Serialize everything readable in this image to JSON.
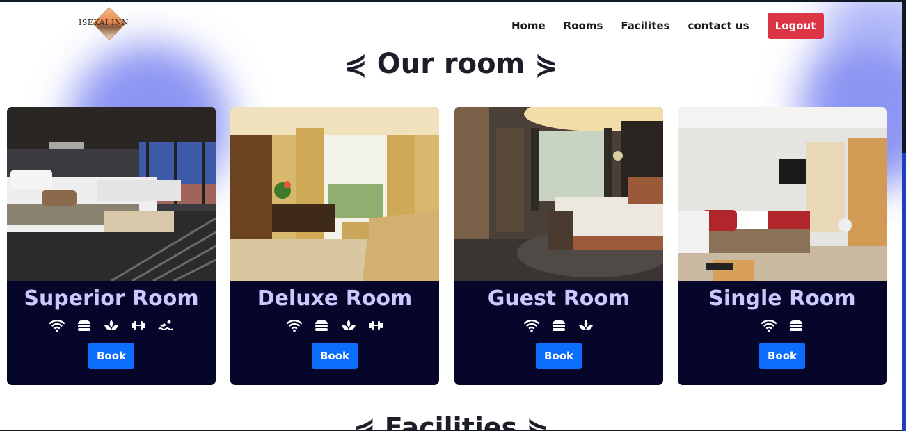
{
  "header": {
    "brand": "ISEKAI INN",
    "nav": [
      "Home",
      "Rooms",
      "Facilites",
      "contact us"
    ],
    "logout_label": "Logout"
  },
  "sections": {
    "rooms_title": "⋞ Our room ⋟",
    "facilities_title": "⋞ Facilities ⋟"
  },
  "rooms": [
    {
      "name": "Superior Room",
      "amenities": [
        "wifi-icon",
        "burger-icon",
        "spa-icon",
        "gym-icon",
        "pool-icon"
      ],
      "book_label": "Book"
    },
    {
      "name": "Deluxe Room",
      "amenities": [
        "wifi-icon",
        "burger-icon",
        "spa-icon",
        "gym-icon"
      ],
      "book_label": "Book"
    },
    {
      "name": "Guest Room",
      "amenities": [
        "wifi-icon",
        "burger-icon",
        "spa-icon"
      ],
      "book_label": "Book"
    },
    {
      "name": "Single Room",
      "amenities": [
        "wifi-icon",
        "burger-icon"
      ],
      "book_label": "Book"
    }
  ],
  "colors": {
    "card_bg": "#06052a",
    "room_name": "#c9c9ff",
    "book_button": "#0d6efd",
    "logout_button": "#dc3545"
  }
}
